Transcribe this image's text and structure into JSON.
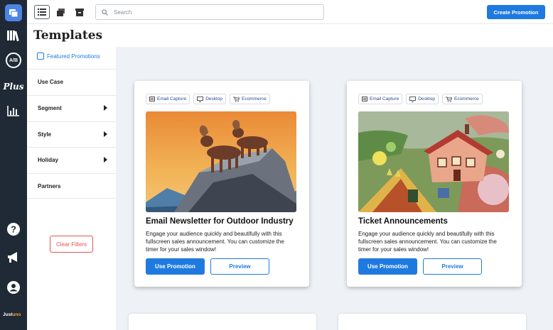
{
  "topbar": {
    "search_placeholder": "Search",
    "create_label": "Create Promotion"
  },
  "page": {
    "title": "Templates"
  },
  "rail": {
    "ab_label": "A/B",
    "plus_label": "Plus",
    "brand_prefix": "Just",
    "brand_suffix": "uno"
  },
  "filters": {
    "featured_label": "Featured Promotions",
    "items": [
      {
        "label": "Use Case"
      },
      {
        "label": "Segment"
      },
      {
        "label": "Style"
      },
      {
        "label": "Holiday"
      },
      {
        "label": "Partners"
      }
    ],
    "clear_label": "Clear Filters"
  },
  "cards": [
    {
      "tags": [
        "Email Capture",
        "Desktop",
        "Ecommerce"
      ],
      "title": "Email Newsletter for Outdoor Industry",
      "description": "Engage your audience quickly and beautifully with this fullscreen sales announcement. You can customize the timer for your sales window!",
      "use_label": "Use Promotion",
      "preview_label": "Preview"
    },
    {
      "tags": [
        "Email Capture",
        "Desktop",
        "Ecommerce"
      ],
      "title": "Ticket Announcements",
      "description": "Engage your audience quickly and beautifully with this fullscreen sales announcement. You can customize the timer for your sales window!",
      "use_label": "Use Promotion",
      "preview_label": "Preview"
    }
  ],
  "colors": {
    "accent": "#1f7ae0",
    "rail": "#1f2a36",
    "danger": "#e25454",
    "content_bg": "#eef1f5"
  }
}
